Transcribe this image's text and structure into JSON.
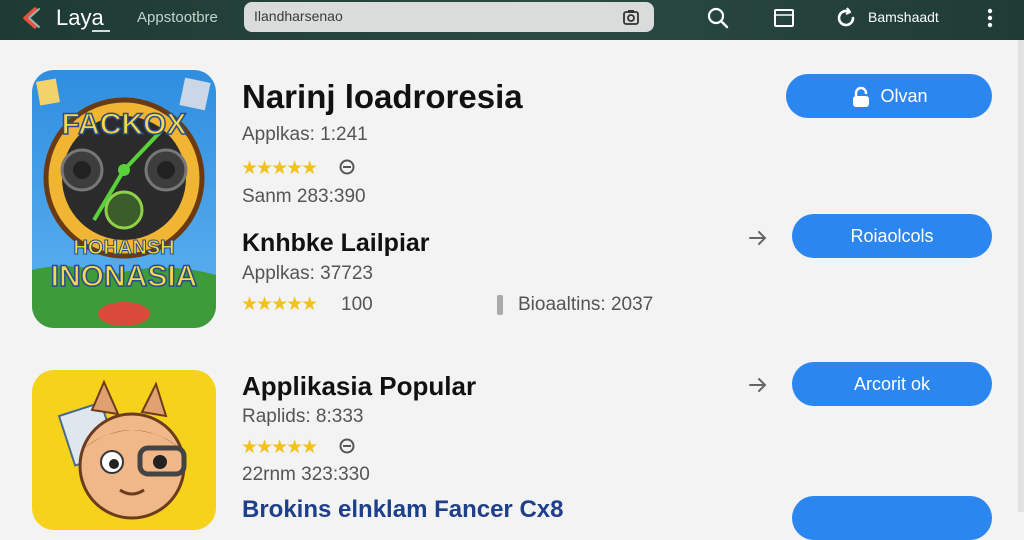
{
  "header": {
    "app_title": "Laya",
    "store_label": "Appstootbre",
    "search_value": "Ilandharsenao",
    "account_label": "Bamshaadt"
  },
  "apps": [
    {
      "name": "Narinj loadroresia",
      "meta_1": "Applkas: 1:241",
      "meta_2": "Sanm 283:390",
      "stars": "★★★★★",
      "action_label": "Olvan",
      "icon_text_top": "FACKOX",
      "icon_text_mid": "HOHANSH",
      "icon_text_bottom": "INONASIA"
    },
    {
      "name": "Knhbke Lailpiar",
      "meta_1": "Applkas: 37723",
      "stars": "★★★★★",
      "rating_count": "100",
      "extra_meta": "Bioaaltins: 2037",
      "action_label": "Roiaolcols"
    },
    {
      "name": "Applikasia Popular",
      "meta_1": "Raplids: 8:333",
      "meta_2": "22rnm 323:330",
      "stars": "★★★★★",
      "action_label": "Arcorit ok"
    },
    {
      "name": "Brokins elnklam Fancer Cx8"
    }
  ],
  "colors": {
    "topbar": "#1f3b35",
    "accent": "#2b86f0",
    "star": "#f2c11b",
    "background": "#f3f3f3"
  }
}
